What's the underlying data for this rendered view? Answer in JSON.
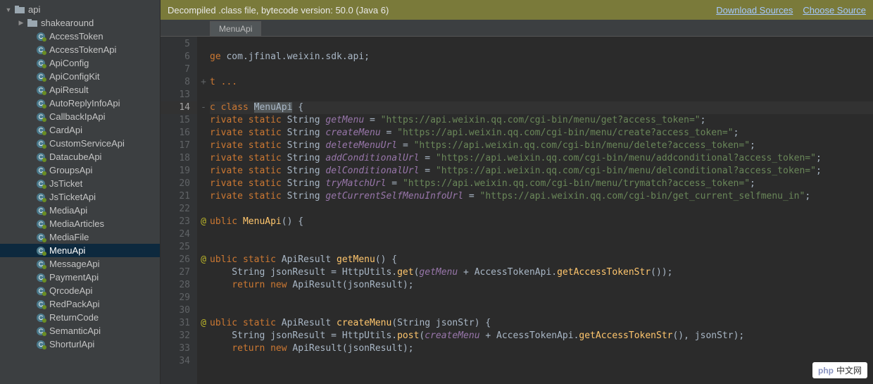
{
  "sidebar": {
    "root": {
      "name": "api",
      "expanded": true
    },
    "folder": {
      "name": "shakearound",
      "expanded": false
    },
    "items": [
      "AccessToken",
      "AccessTokenApi",
      "ApiConfig",
      "ApiConfigKit",
      "ApiResult",
      "AutoReplyInfoApi",
      "CallbackIpApi",
      "CardApi",
      "CustomServiceApi",
      "DatacubeApi",
      "GroupsApi",
      "JsTicket",
      "JsTicketApi",
      "MediaApi",
      "MediaArticles",
      "MediaFile",
      "MenuApi",
      "MessageApi",
      "PaymentApi",
      "QrcodeApi",
      "RedPackApi",
      "ReturnCode",
      "SemanticApi",
      "ShorturlApi"
    ],
    "selected": "MenuApi"
  },
  "banner": {
    "text": "Decompiled .class file, bytecode version: 50.0 (Java 6)",
    "download": "Download Sources",
    "choose": "Choose Source"
  },
  "tabs": {
    "active": "MenuApi"
  },
  "code": {
    "lines": [
      5,
      6,
      7,
      8,
      13,
      14,
      15,
      16,
      17,
      18,
      19,
      20,
      21,
      22,
      23,
      24,
      25,
      26,
      27,
      28,
      29,
      30,
      31,
      32,
      33,
      34
    ],
    "hl_line": 14,
    "package": "com.jfinal.weixin.sdk.api",
    "import_fold": "t ...",
    "class_name": "MenuApi",
    "fields": [
      {
        "name": "getMenu",
        "url": "https://api.weixin.qq.com/cgi-bin/menu/get?access_token="
      },
      {
        "name": "createMenu",
        "url": "https://api.weixin.qq.com/cgi-bin/menu/create?access_token="
      },
      {
        "name": "deleteMenuUrl",
        "url": "https://api.weixin.qq.com/cgi-bin/menu/delete?access_token="
      },
      {
        "name": "addConditionalUrl",
        "url": "https://api.weixin.qq.com/cgi-bin/menu/addconditional?access_token="
      },
      {
        "name": "delConditionalUrl",
        "url": "https://api.weixin.qq.com/cgi-bin/menu/delconditional?access_token="
      },
      {
        "name": "tryMatchUrl",
        "url": "https://api.weixin.qq.com/cgi-bin/menu/trymatch?access_token="
      },
      {
        "name": "getCurrentSelfMenuInfoUrl",
        "url": "https://api.weixin.qq.com/cgi-bin/get_current_selfmenu_in"
      }
    ],
    "ctor": "ublic MenuApi() {",
    "m1_sig": "ublic static ApiResult getMenu() {",
    "m1_l1a": "    String jsonResult = HttpUtils.",
    "m1_l1b": "get",
    "m1_l1c": "(",
    "m1_l1d": "getMenu",
    "m1_l1e": " + AccessTokenApi.",
    "m1_l1f": "getAccessTokenStr",
    "m1_l1g": "());",
    "m1_l2a": "    ",
    "m1_l2b": "return new",
    "m1_l2c": " ApiResult(jsonResult);",
    "m2_sig": "ublic static ApiResult createMenu(String jsonStr) {",
    "m2_l1a": "    String jsonResult = HttpUtils.",
    "m2_l1b": "post",
    "m2_l1c": "(",
    "m2_l1d": "createMenu",
    "m2_l1e": " + AccessTokenApi.",
    "m2_l1f": "getAccessTokenStr",
    "m2_l1g": "(), jsonStr);",
    "m2_l2a": "    ",
    "m2_l2b": "return new",
    "m2_l2c": " ApiResult(jsonResult);"
  },
  "watermark": {
    "l": "php",
    "r": "中文网"
  }
}
